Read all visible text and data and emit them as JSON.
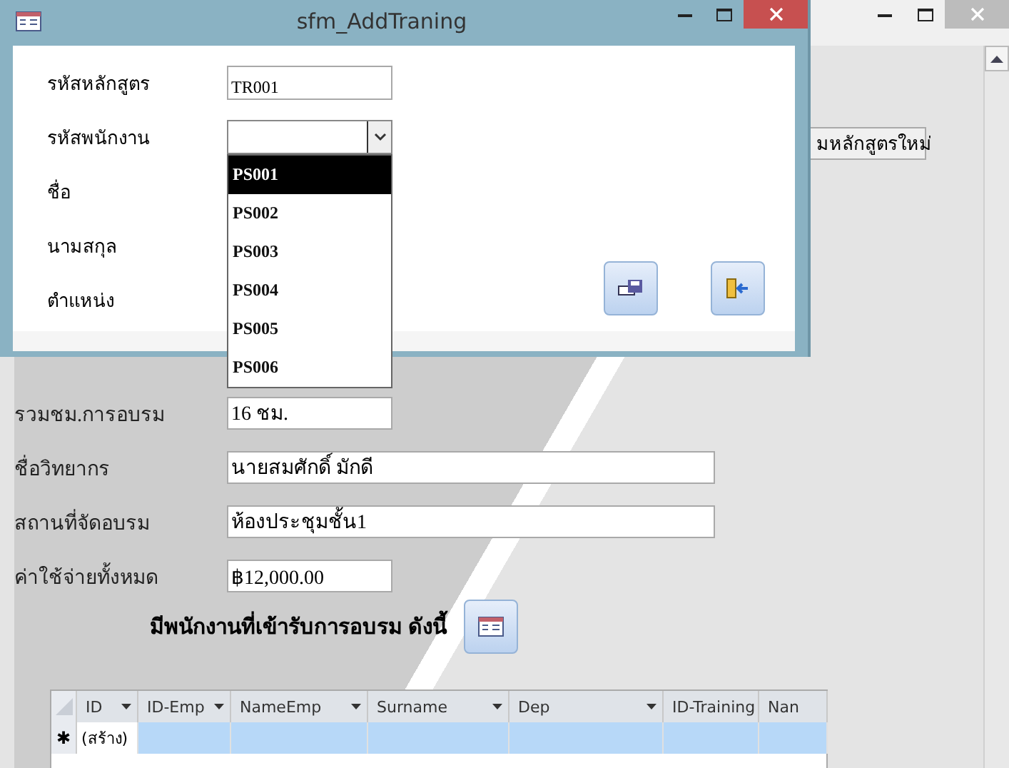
{
  "main_window": {
    "new_course_button": "มหลักสูตรใหม่",
    "fields": [
      {
        "label": "รวมชม.การอบรม",
        "value": "16 ชม.",
        "wide": false
      },
      {
        "label": "ชื่อวิทยากร",
        "value": "นายสมศักดิ์ มักดี",
        "wide": true
      },
      {
        "label": "สถานที่จัดอบรม",
        "value": "ห้องประชุมชั้น1",
        "wide": true
      },
      {
        "label": "ค่าใช้จ่ายทั้งหมด",
        "value": "฿12,000.00",
        "wide": false
      }
    ],
    "heading": "มีพนักงานที่เข้ารับการอบรม ดังนี้",
    "datasheet": {
      "columns": [
        "ID",
        "ID-Emp",
        "NameEmp",
        "Surname",
        "Dep",
        "ID-Training",
        "Nan"
      ],
      "new_row": {
        "marker": "✱",
        "id": "(สร้าง)"
      }
    }
  },
  "dialog": {
    "title": "sfm_AddTraning",
    "fields": [
      {
        "kind": "text",
        "label": "รหัสหลักสูตร",
        "value": "TR001"
      },
      {
        "kind": "combo",
        "label": "รหัสพนักงาน",
        "expanded": true,
        "options": [
          {
            "text": "PS001",
            "selected": true
          },
          {
            "text": "PS002",
            "selected": false
          },
          {
            "text": "PS003",
            "selected": false
          },
          {
            "text": "PS004",
            "selected": false
          },
          {
            "text": "PS005",
            "selected": false
          },
          {
            "text": "PS006",
            "selected": false
          }
        ]
      },
      {
        "kind": "label",
        "label": "ชื่อ"
      },
      {
        "kind": "label",
        "label": "นามสกุล"
      },
      {
        "kind": "label",
        "label": "ตำแหน่ง"
      }
    ]
  }
}
